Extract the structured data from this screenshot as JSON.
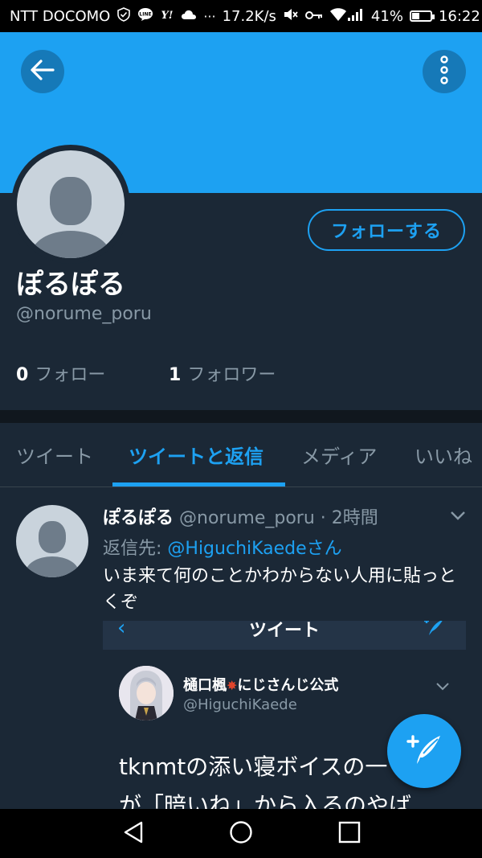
{
  "status_bar": {
    "carrier": "NTT DOCOMO",
    "network_speed": "17.2K/s",
    "battery_percent": "41%",
    "battery_level": 0.41,
    "time": "16:22"
  },
  "header": {
    "accent_color": "#1da1f2",
    "back_icon": "arrow-left-icon",
    "menu_icon": "more-vertical-icon"
  },
  "profile": {
    "display_name": "ぽるぽる",
    "handle": "@norume_poru",
    "follow_label": "フォローする",
    "following_count": "0",
    "following_label": "フォロー",
    "followers_count": "1",
    "followers_label": "フォロワー"
  },
  "tabs": [
    {
      "label": "ツイート",
      "active": false
    },
    {
      "label": "ツイートと返信",
      "active": true
    },
    {
      "label": "メディア",
      "active": false
    },
    {
      "label": "いいね",
      "active": false
    }
  ],
  "tweet": {
    "author_name": "ぽるぽる",
    "author_handle": "@norume_poru",
    "separator": " · ",
    "timestamp": "2時間",
    "reply_prefix": "返信先: ",
    "reply_to": "@HiguchiKaedeさん",
    "text": "いま来て何のことかわからない人用に貼っとくぞ",
    "embed": {
      "bar_title": "ツイート",
      "author_name": "樋口楓",
      "author_suffix": "にじさんじ公式",
      "author_handle": "@HiguchiKaede",
      "text_line1": "tknmtの添い寝ボイスの一",
      "text_line2": "が「暗いね」から入るのやば"
    }
  },
  "fab": {
    "icon": "compose-tweet-icon"
  }
}
